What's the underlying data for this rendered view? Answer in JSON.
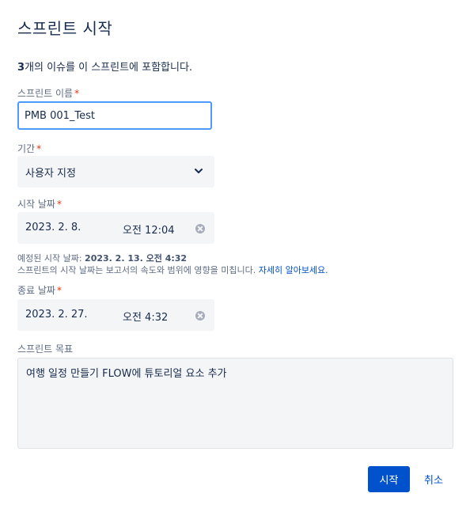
{
  "dialog": {
    "title": "스프린트 시작",
    "summary": {
      "count": "3",
      "text": "개의 이슈를 이 스프린트에 포함합니다."
    }
  },
  "sprint_name": {
    "label": "스프린트 이름",
    "value": "PMB 001_Test"
  },
  "duration": {
    "label": "기간",
    "selected": "사용자 지정"
  },
  "start_date": {
    "label": "시작 날짜",
    "date": "2023. 2. 8.",
    "time": "오전 12:04"
  },
  "start_help": {
    "line1_prefix": "예정된 시작 날짜: ",
    "line1_value": "2023. 2. 13. 오전 4:32",
    "line2_text": "스프린트의 시작 날짜는 보고서의 속도와 범위에 영향을 미칩니다. ",
    "line2_link": "자세히 알아보세요."
  },
  "end_date": {
    "label": "종료 날짜",
    "date": "2023. 2. 27.",
    "time": "오전 4:32"
  },
  "goal": {
    "label": "스프린트 목표",
    "value": "여행 일정 만들기 FLOW에 튜토리얼 요소 추가"
  },
  "buttons": {
    "start": "시작",
    "cancel": "취소"
  },
  "required_marker": "*",
  "colors": {
    "primary": "#0052cc",
    "focus": "#4c9aff",
    "required": "#de350b",
    "field_bg": "#f4f5f7"
  }
}
